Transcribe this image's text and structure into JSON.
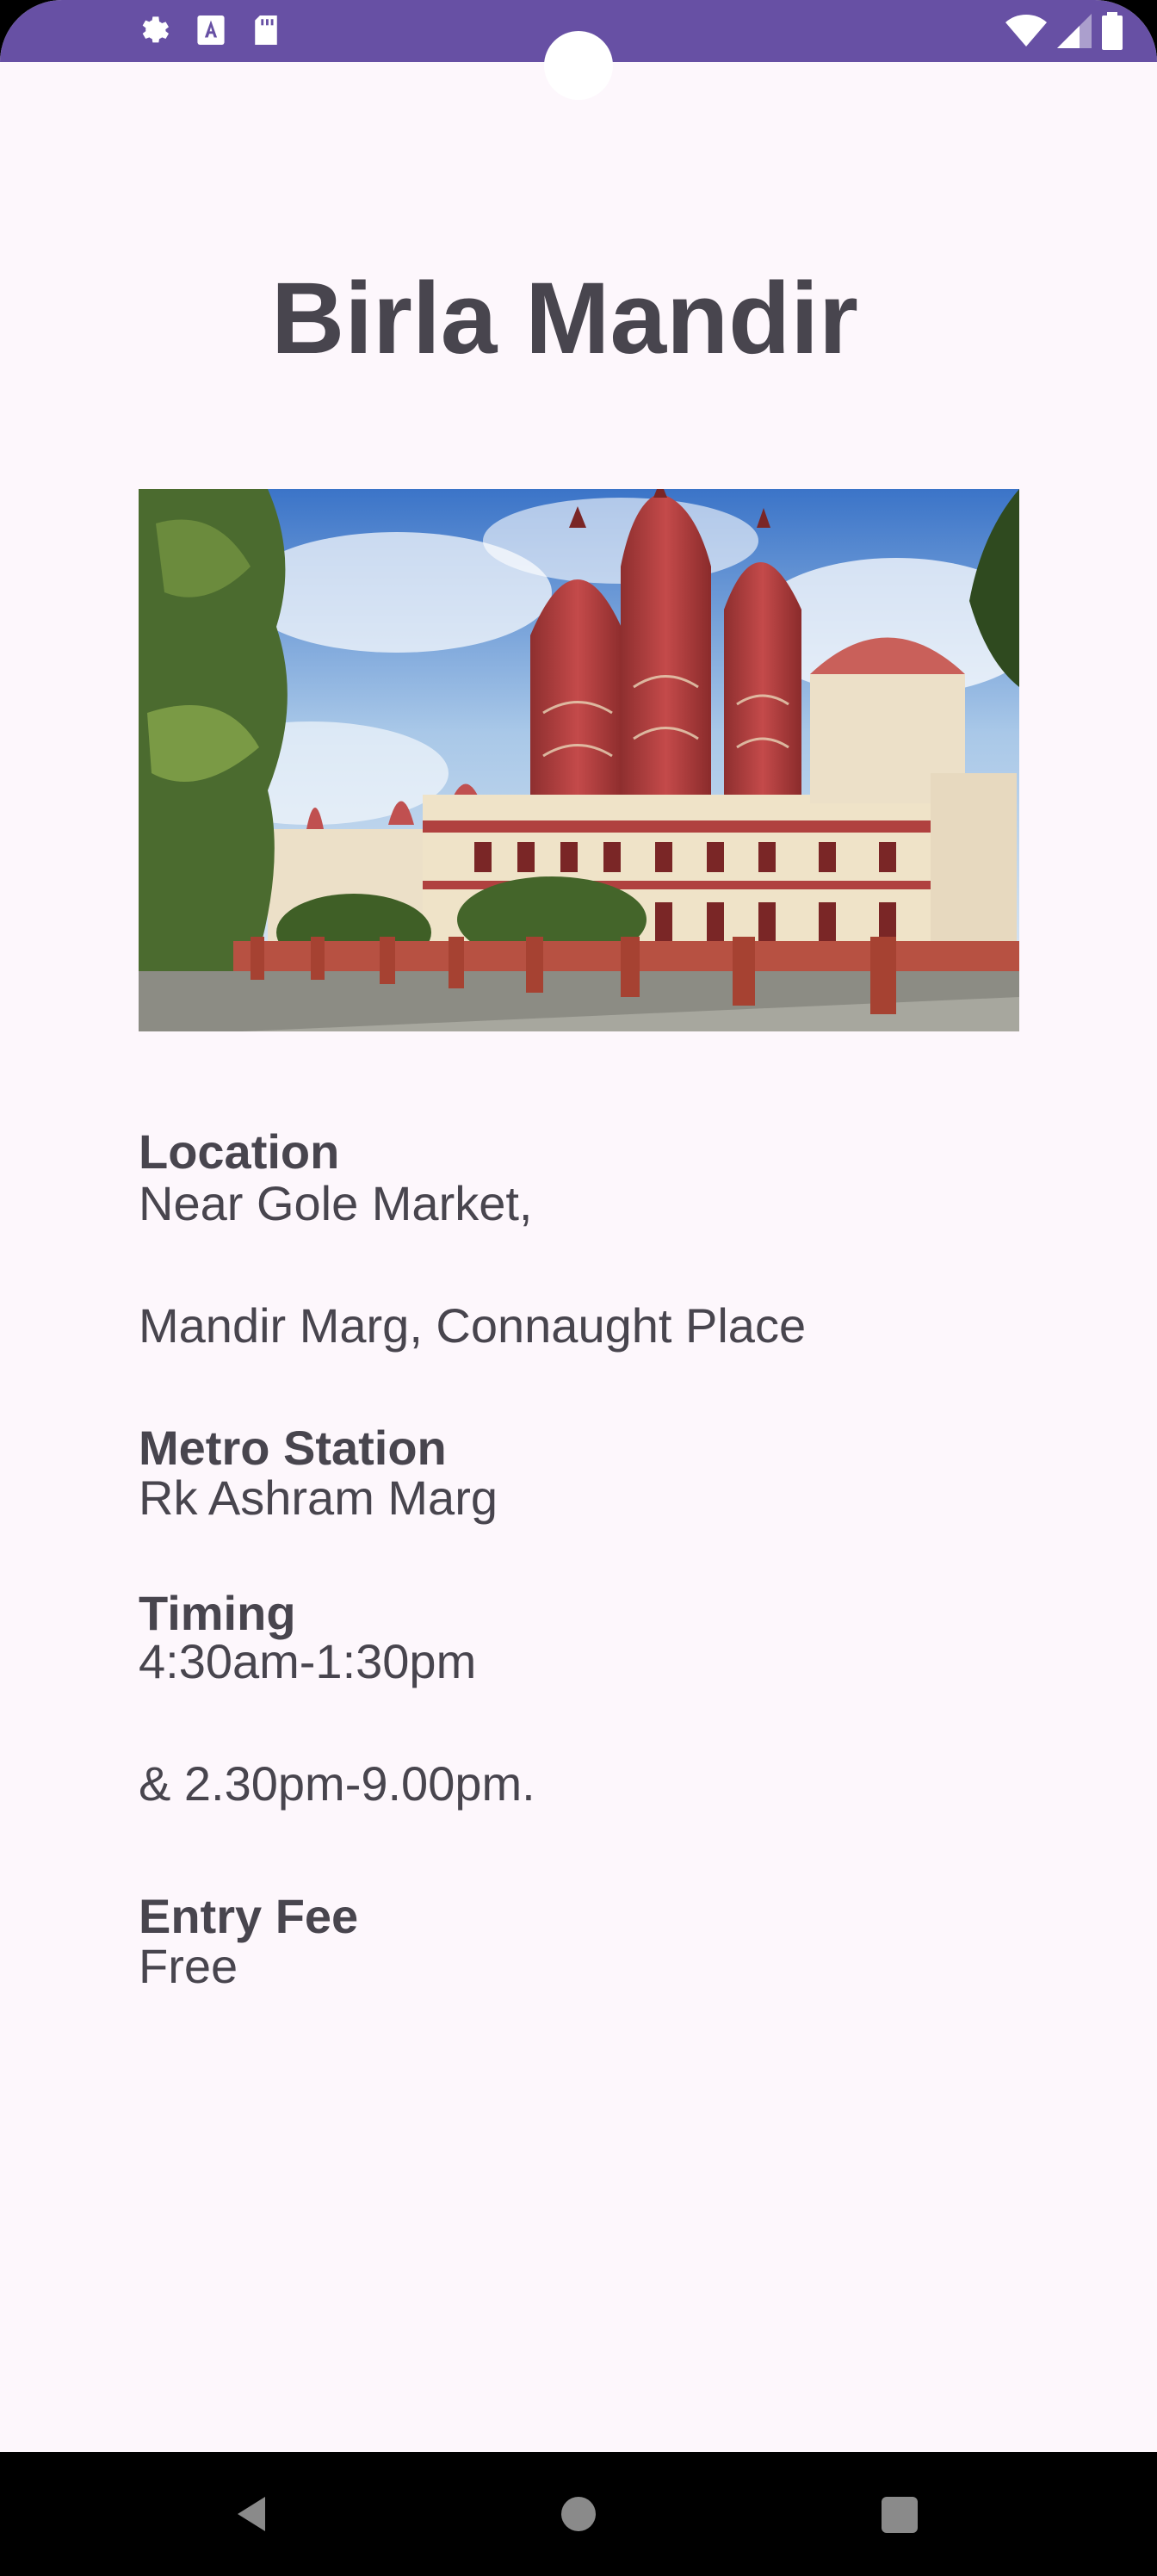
{
  "status_bar": {
    "left_icons": [
      "gear-icon",
      "font-a-icon",
      "sd-card-icon"
    ],
    "right_icons": [
      "wifi-icon",
      "cellular-signal-icon",
      "battery-icon"
    ]
  },
  "page": {
    "title": "Birla Mandir"
  },
  "details": {
    "location_label": "Location",
    "location_line1": "Near Gole Market,",
    "location_line2": "Mandir Marg, Connaught Place",
    "metro_label": "Metro Station",
    "metro_value": "Rk Ashram Marg",
    "timing_label": "Timing",
    "timing_line1": "4:30am-1:30pm",
    "timing_line2": "& 2.30pm-9.00pm.",
    "fee_label": "Entry Fee",
    "fee_value": "Free"
  },
  "nav_bar": {
    "buttons": [
      "back-icon",
      "home-icon",
      "recents-icon"
    ]
  },
  "colors": {
    "status_bar": "#6750a4",
    "background": "#fdf7fc",
    "text": "#48454e"
  }
}
